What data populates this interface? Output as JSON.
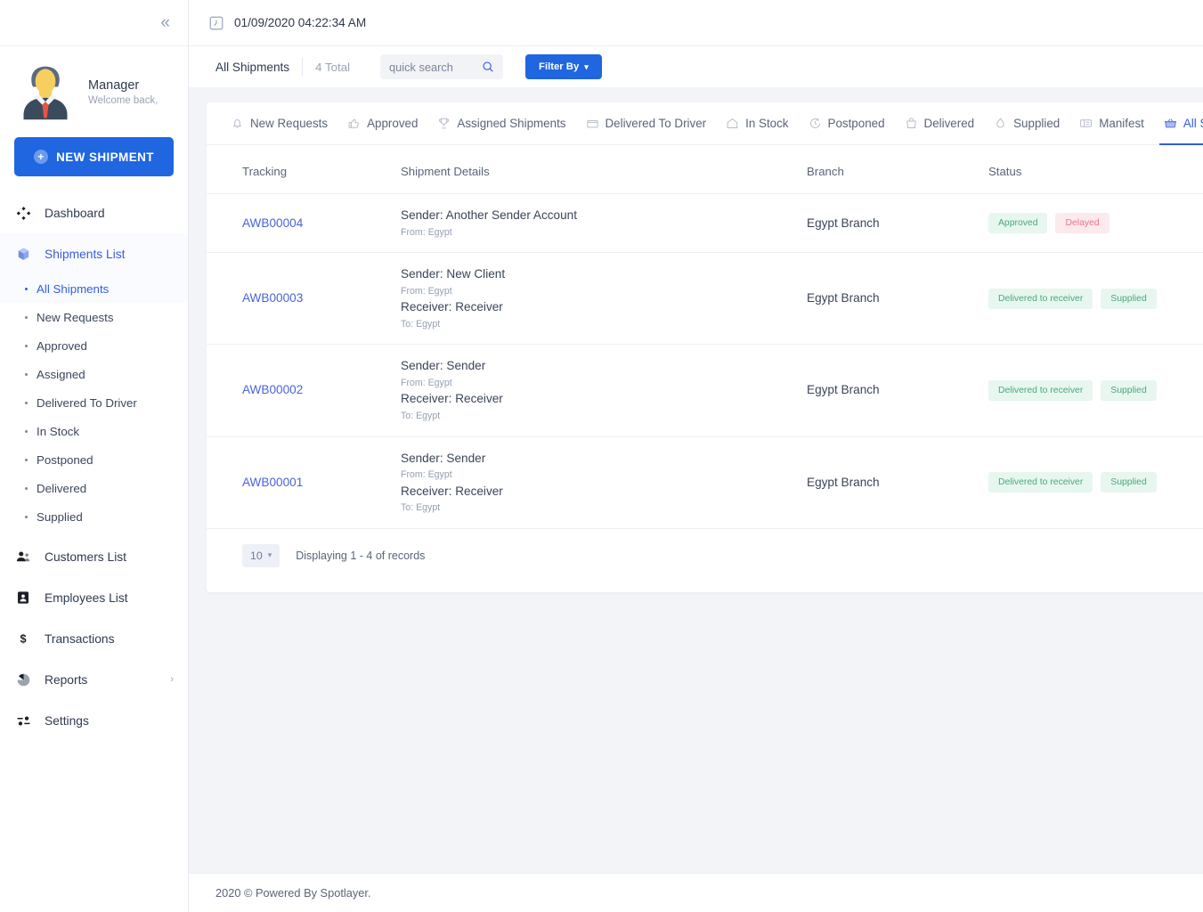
{
  "sidebar": {
    "collapse_icon": "chevrons-left-icon",
    "profile": {
      "name": "Manager",
      "subtitle": "Welcome back,",
      "avatar_icon": "user-avatar"
    },
    "new_shipment_button": "NEW SHIPMENT",
    "nav": [
      {
        "label": "Dashboard",
        "icon": "dashboard-icon",
        "active": false,
        "caret": ""
      },
      {
        "label": "Shipments List",
        "icon": "shipments-cube-icon",
        "active": true,
        "caret": "ⱟ"
      }
    ],
    "sub_items": [
      {
        "label": "All Shipments",
        "active": true
      },
      {
        "label": "New Requests",
        "active": false
      },
      {
        "label": "Approved",
        "active": false
      },
      {
        "label": "Assigned",
        "active": false
      },
      {
        "label": "Delivered To Driver",
        "active": false
      },
      {
        "label": "In Stock",
        "active": false
      },
      {
        "label": "Postponed",
        "active": false
      },
      {
        "label": "Delivered",
        "active": false
      },
      {
        "label": "Supplied",
        "active": false
      }
    ],
    "nav_bottom": [
      {
        "label": "Customers List",
        "icon": "customers-icon",
        "caret": ""
      },
      {
        "label": "Employees List",
        "icon": "employee-badge-icon",
        "caret": ""
      },
      {
        "label": "Transactions",
        "icon": "dollar-icon",
        "caret": ""
      },
      {
        "label": "Reports",
        "icon": "pie-chart-icon",
        "caret": "›"
      },
      {
        "label": "Settings",
        "icon": "sliders-icon",
        "caret": ""
      }
    ]
  },
  "topbar": {
    "clock_icon": "clock-icon",
    "datetime": "01/09/2020 04:22:34 AM"
  },
  "toolbar": {
    "title": "All Shipments",
    "total": "4 Total",
    "search_placeholder": "quick search",
    "search_value": "",
    "search_icon": "search-icon",
    "filter_label": "Filter By",
    "filter_caret": "ⱟ"
  },
  "tabs": [
    {
      "label": "New Requests",
      "icon": "bell-icon",
      "active": false
    },
    {
      "label": "Approved",
      "icon": "thumbs-up-icon",
      "active": false
    },
    {
      "label": "Assigned Shipments",
      "icon": "trophy-icon",
      "active": false
    },
    {
      "label": "Delivered To Driver",
      "icon": "box-icon",
      "active": false
    },
    {
      "label": "In Stock",
      "icon": "home-icon",
      "active": false
    },
    {
      "label": "Postponed",
      "icon": "clock-arrow-icon",
      "active": false
    },
    {
      "label": "Delivered",
      "icon": "bag-icon",
      "active": false
    },
    {
      "label": "Supplied",
      "icon": "drop-icon",
      "active": false
    },
    {
      "label": "Manifest",
      "icon": "manifest-icon",
      "active": false
    },
    {
      "label": "All Shipments",
      "icon": "basket-icon",
      "active": true
    }
  ],
  "table": {
    "columns": [
      "Tracking",
      "Shipment Details",
      "Branch",
      "Status"
    ],
    "rows": [
      {
        "tracking": "AWB00004",
        "sender": "Sender: Another Sender Account",
        "from": "From: Egypt",
        "receiver": "",
        "to": "",
        "branch": "Egypt Branch",
        "badges": [
          {
            "label": "Approved",
            "tone": "green"
          },
          {
            "label": "Delayed",
            "tone": "red"
          }
        ]
      },
      {
        "tracking": "AWB00003",
        "sender": "Sender: New Client",
        "from": "From: Egypt",
        "receiver": "Receiver: Receiver",
        "to": "To: Egypt",
        "branch": "Egypt Branch",
        "badges": [
          {
            "label": "Delivered to receiver",
            "tone": "green"
          },
          {
            "label": "Supplied",
            "tone": "green"
          }
        ]
      },
      {
        "tracking": "AWB00002",
        "sender": "Sender: Sender",
        "from": "From: Egypt",
        "receiver": "Receiver: Receiver",
        "to": "To: Egypt",
        "branch": "Egypt Branch",
        "badges": [
          {
            "label": "Delivered to receiver",
            "tone": "green"
          },
          {
            "label": "Supplied",
            "tone": "green"
          }
        ]
      },
      {
        "tracking": "AWB00001",
        "sender": "Sender: Sender",
        "from": "From: Egypt",
        "receiver": "Receiver: Receiver",
        "to": "To: Egypt",
        "branch": "Egypt Branch",
        "badges": [
          {
            "label": "Delivered to receiver",
            "tone": "green"
          },
          {
            "label": "Supplied",
            "tone": "green"
          }
        ]
      }
    ]
  },
  "pagination": {
    "page_size": "10",
    "page_size_caret": "ⱟ",
    "summary": "Displaying 1 - 4 of records"
  },
  "footer": {
    "text": "2020 © Powered By Spotlayer."
  },
  "colors": {
    "accent": "#1f66e0",
    "link": "#4a63d8",
    "badge_green_bg": "#e7f7ef",
    "badge_green_fg": "#4aa77d",
    "badge_red_bg": "#fdeaee",
    "badge_red_fg": "#e8738d",
    "page_bg": "#f3f4f8"
  }
}
